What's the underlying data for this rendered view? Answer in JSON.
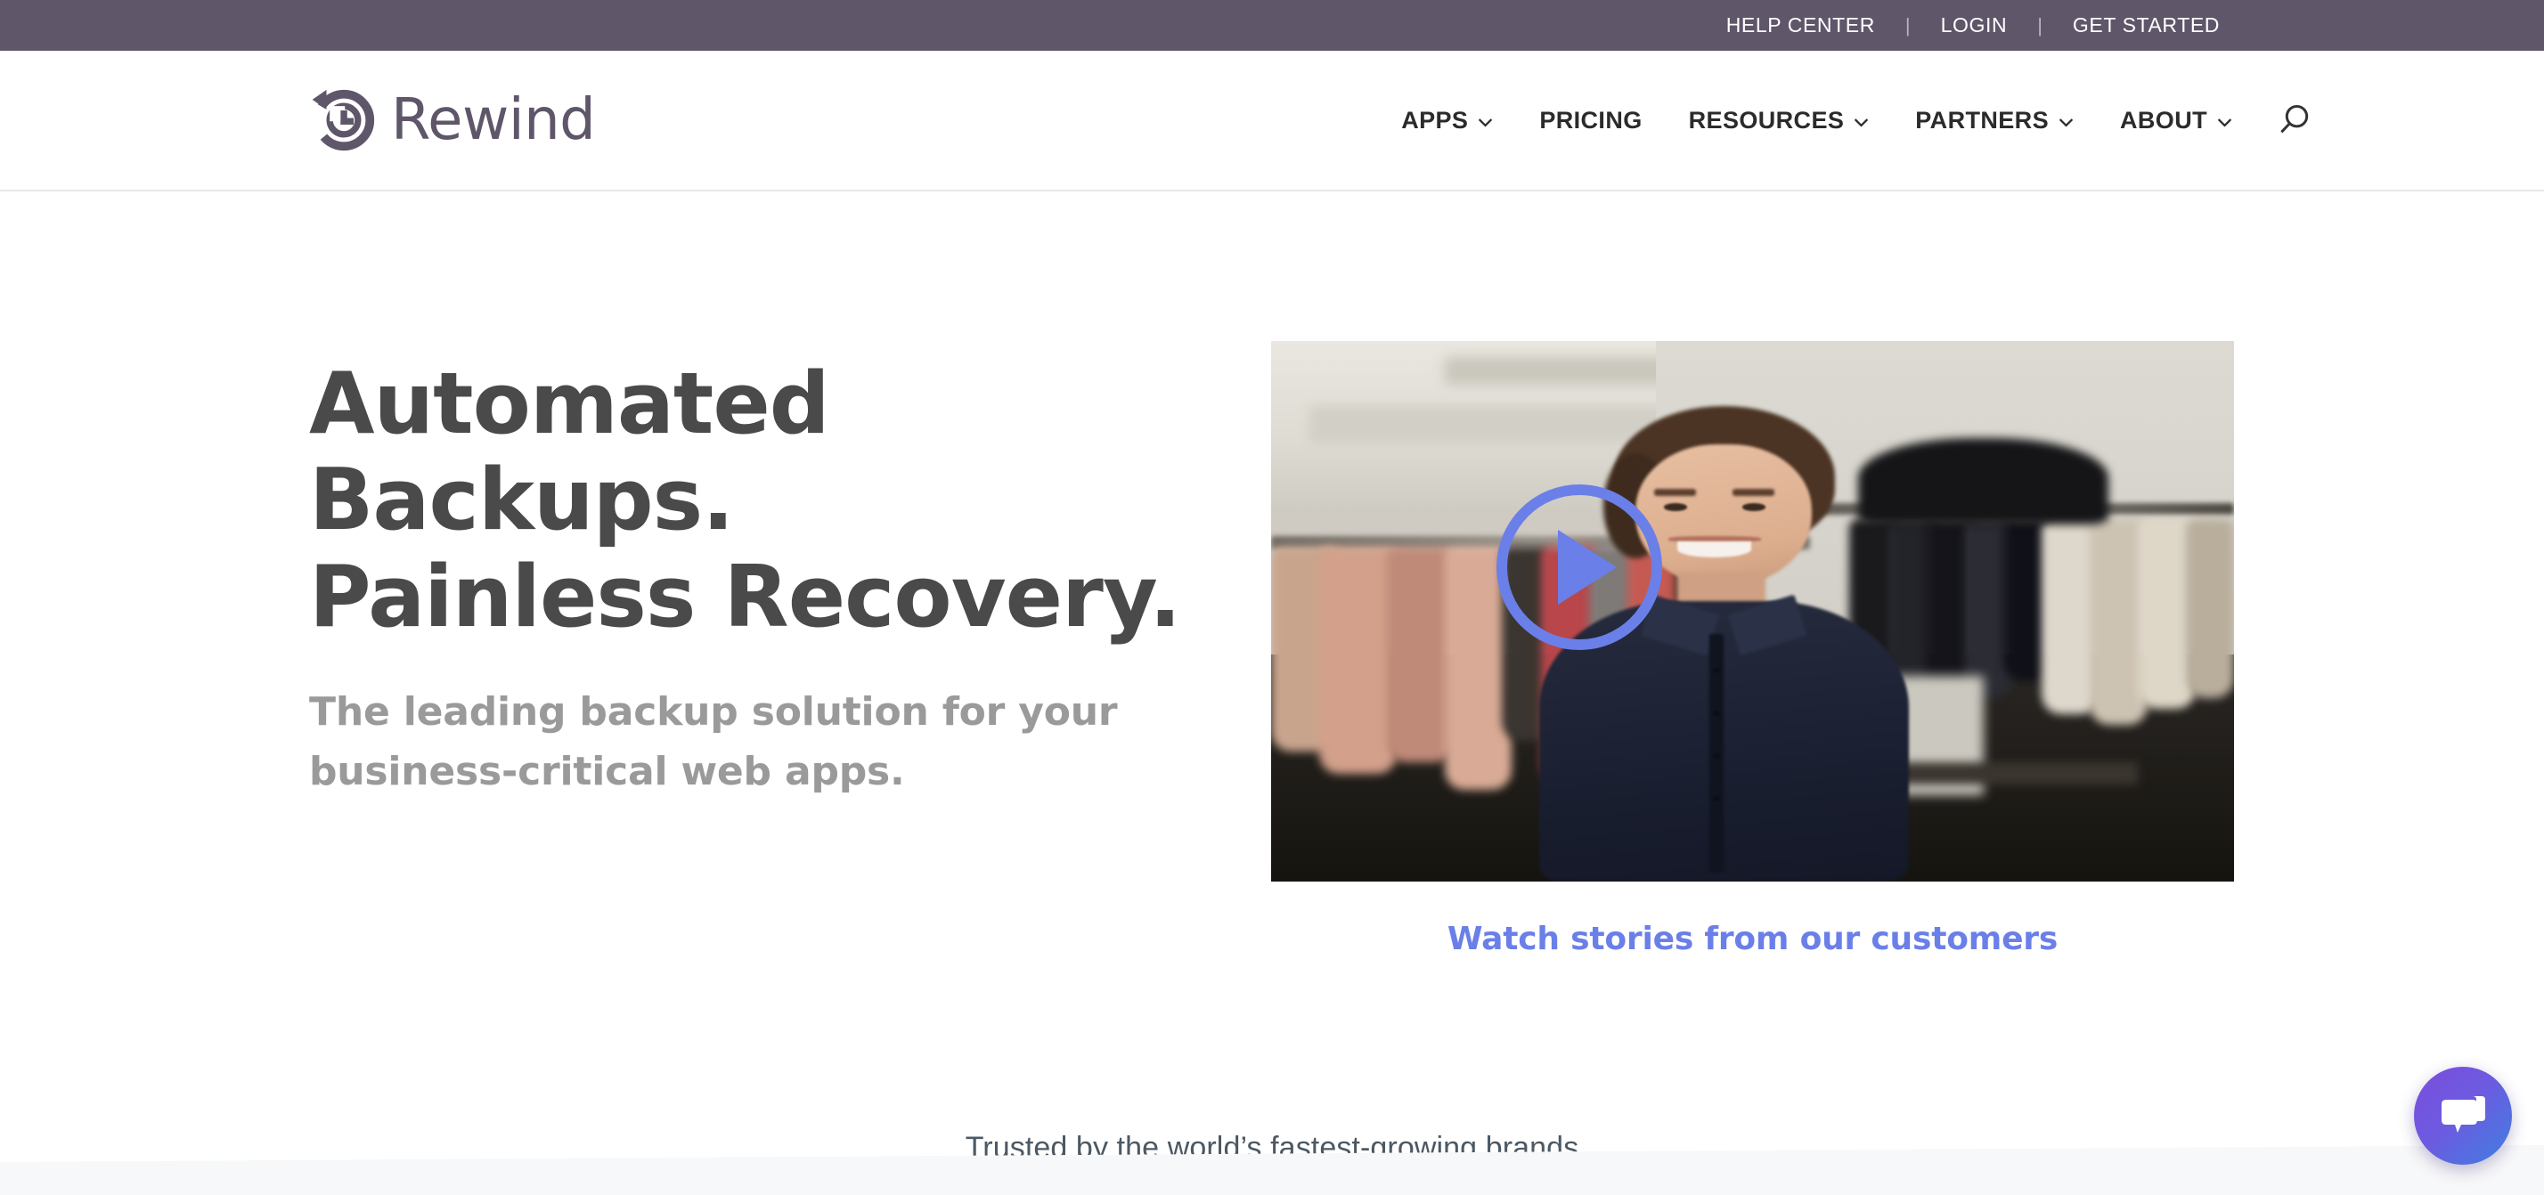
{
  "topbar": {
    "links": [
      {
        "label": "HELP CENTER",
        "name": "help-center"
      },
      {
        "label": "LOGIN",
        "name": "login"
      },
      {
        "label": "GET STARTED",
        "name": "get-started"
      }
    ],
    "separator": "|",
    "background_color": "#5f566a"
  },
  "header": {
    "logo": {
      "text": "Rewind",
      "icon": "rewind-clock-icon",
      "color": "#5f566a"
    },
    "nav": [
      {
        "label": "APPS",
        "has_dropdown": true,
        "icon": "chevron-down-icon"
      },
      {
        "label": "PRICING",
        "has_dropdown": false,
        "icon": ""
      },
      {
        "label": "RESOURCES",
        "has_dropdown": true,
        "icon": "chevron-down-icon"
      },
      {
        "label": "PARTNERS",
        "has_dropdown": true,
        "icon": "chevron-down-icon"
      },
      {
        "label": "ABOUT",
        "has_dropdown": true,
        "icon": "chevron-down-icon"
      }
    ],
    "search_icon": "search-icon"
  },
  "hero": {
    "title_line1": "Automated Backups.",
    "title_line2": "Painless Recovery.",
    "title_color": "#4a4a4a",
    "subtitle_line1": "The leading backup solution for your",
    "subtitle_line2": "business-critical web apps.",
    "subtitle_color": "#9a9a9a"
  },
  "video": {
    "play_icon": "play-button-icon",
    "accent_color": "#6b7fe8",
    "caption_link": "Watch stories from our customers",
    "alt_description": "Smiling woman in a navy button-up shirt standing in a boutique clothing store with racks of garments behind her"
  },
  "trusted": {
    "text": "Trusted by the world’s fastest-growing brands",
    "color": "#4c5863"
  },
  "chat": {
    "icon": "chat-bubble-icon",
    "gradient_start": "#7b4ddb",
    "gradient_end": "#3f7fe0"
  }
}
